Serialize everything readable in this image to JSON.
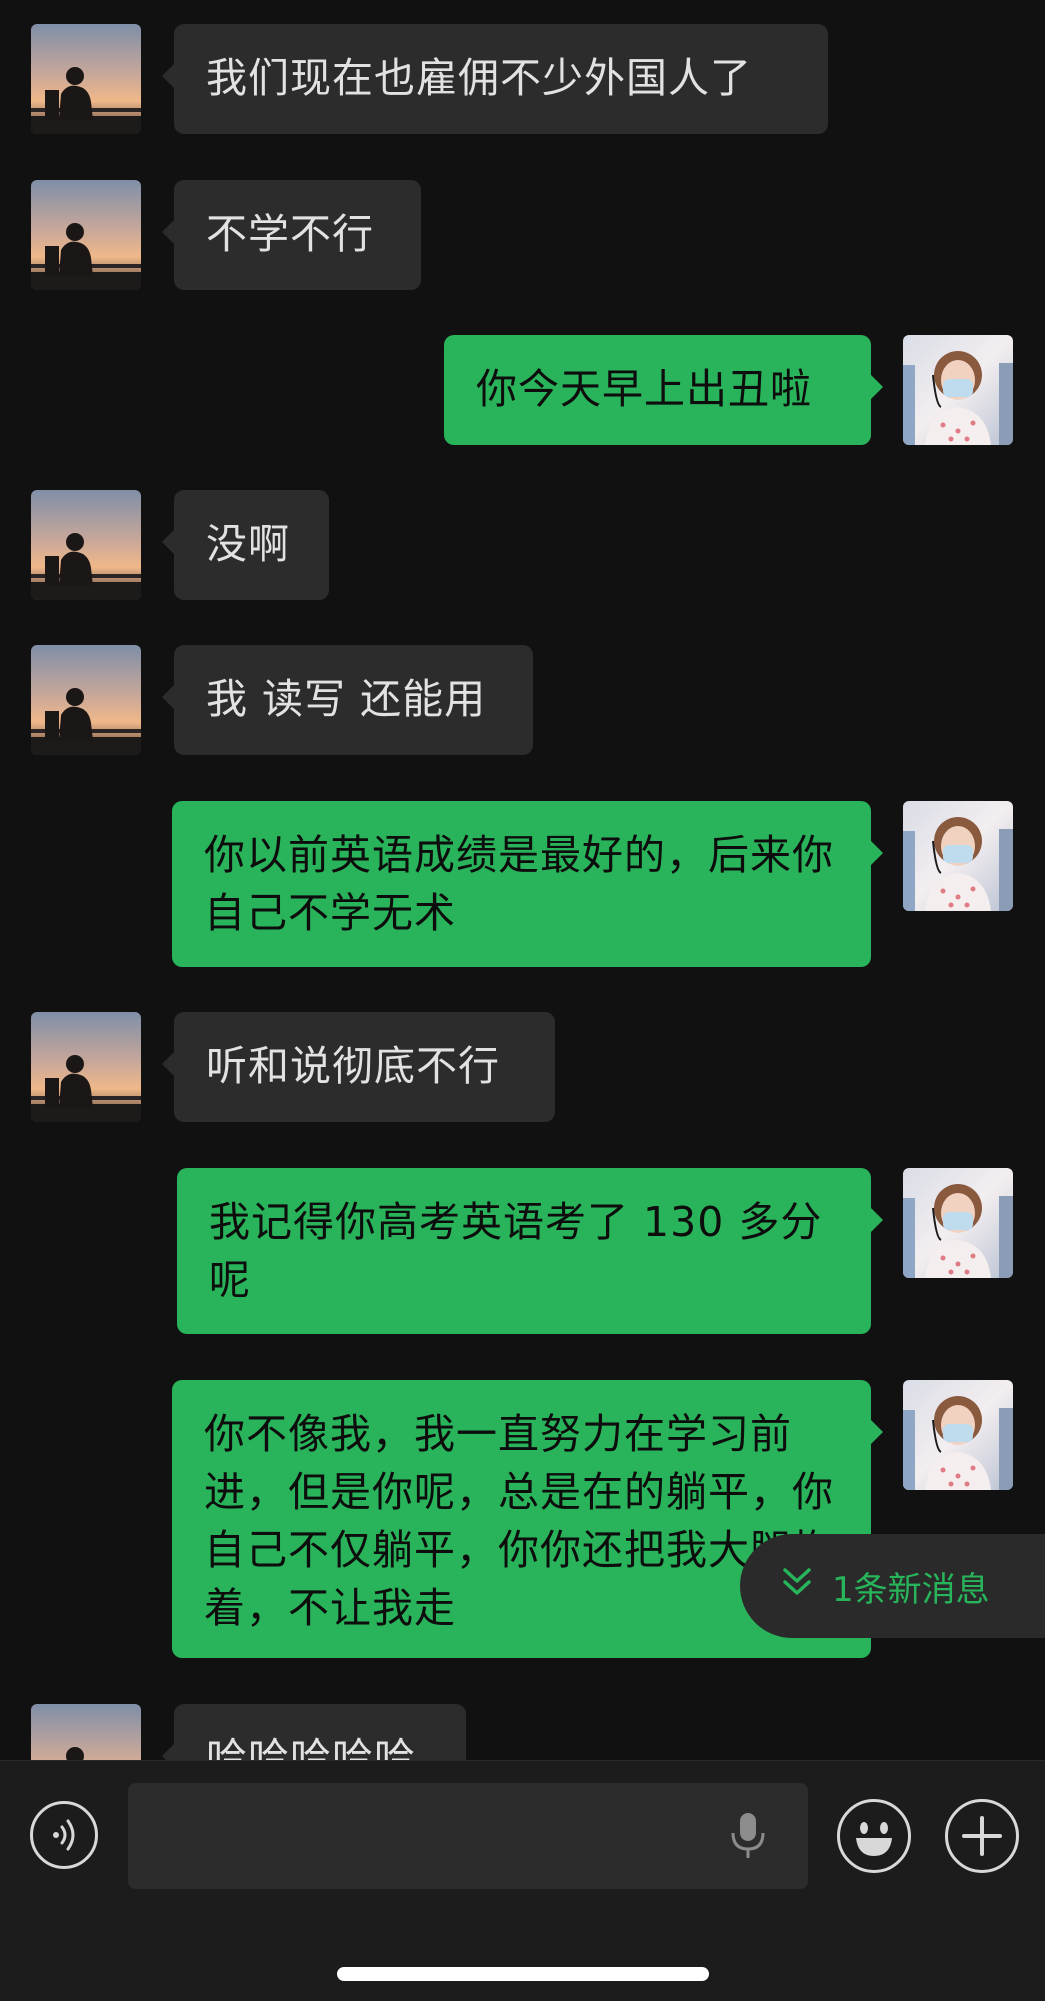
{
  "messages": [
    {
      "side": "in",
      "text": "我们现在也雇佣不少外国人了"
    },
    {
      "side": "in",
      "text": "不学不行"
    },
    {
      "side": "out",
      "text": "你今天早上出丑啦"
    },
    {
      "side": "in",
      "text": "没啊"
    },
    {
      "side": "in",
      "text": "我 读写 还能用"
    },
    {
      "side": "out",
      "text": "你以前英语成绩是最好的，后来你自己不学无术"
    },
    {
      "side": "in",
      "text": "听和说彻底不行"
    },
    {
      "side": "out",
      "text": "我记得你高考英语考了 130 多分呢"
    },
    {
      "side": "out",
      "text": "你不像我，我一直努力在学习前进，但是你呢，总是在的躺平，你自己不仅躺平，你你还把我大腿抱着，不让我走"
    },
    {
      "side": "in",
      "text": "哈哈哈哈哈"
    }
  ],
  "new_message_pill": {
    "label": "1条新消息"
  },
  "input": {
    "value": "",
    "placeholder": ""
  },
  "colors": {
    "outgoing_bubble": "#29b35a",
    "incoming_bubble": "#2c2c2c",
    "background": "#111111",
    "accent": "#27b45a"
  },
  "icons": {
    "voice": "voice-icon",
    "mic": "mic-icon",
    "emoji": "emoji-icon",
    "plus": "plus-icon",
    "chevron": "double-chevron-down-icon"
  }
}
